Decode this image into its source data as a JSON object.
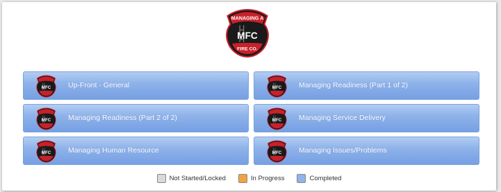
{
  "logo": {
    "top_text": "MANAGING A",
    "middle_text": "MFC",
    "bottom_text": "FIRE CO."
  },
  "modules": [
    {
      "label": "Up-Front - General",
      "status": "Completed"
    },
    {
      "label": "Managing Readiness (Part 1 of 2)",
      "status": "Completed"
    },
    {
      "label": "Managing Readiness (Part 2 of 2)",
      "status": "Completed"
    },
    {
      "label": "Managing Service Delivery",
      "status": "Completed"
    },
    {
      "label": "Managing Human Resource",
      "status": "Completed"
    },
    {
      "label": "Managing Issues/Problems",
      "status": "Completed"
    }
  ],
  "legend": [
    {
      "label": "Not Started/Locked",
      "color": "#d9d9d9"
    },
    {
      "label": "In Progress",
      "color": "#f0a444"
    },
    {
      "label": "Completed",
      "color": "#8fb3ea"
    }
  ],
  "icons": {
    "logo": "fire-company-badge-logo",
    "module_badge": "fire-company-badge-icon"
  }
}
